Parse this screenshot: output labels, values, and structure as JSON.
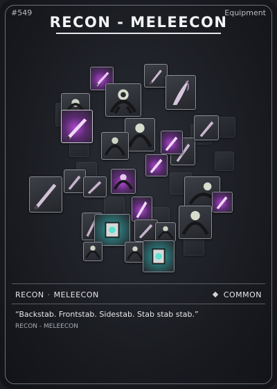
{
  "card": {
    "id": "#549",
    "category": "Equipment",
    "title": "RECON - MELEECON"
  },
  "info": {
    "name_primary": "RECON",
    "separator": "·",
    "name_secondary": "MELEECON",
    "rarity": "COMMON",
    "flavor_text": "“Backstab. Frontstab. Sidestab. Stab stab stab.”",
    "subline": "RECON - MELEECON"
  },
  "colors": {
    "accent_purple": "#b04ad0",
    "accent_teal": "#38c9b8",
    "frame": "#6e7178"
  },
  "art": {
    "description_icons": [
      "knife-icon",
      "claw-icon",
      "scythe-icon",
      "emitter-icon"
    ]
  }
}
